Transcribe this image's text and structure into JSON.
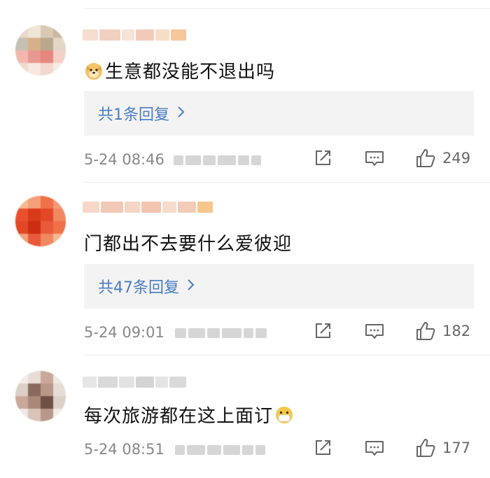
{
  "comments": [
    {
      "content": "生意都没能不退出吗",
      "emoji": "doge-emoji",
      "reply_label": "共1条回复",
      "time": "5-24 08:46",
      "likes": "249",
      "avatar_colors": [
        "#e8d9c8",
        "#f0e6d8",
        "#d8c8b4",
        "#c9b7a4",
        "#f2b8b0",
        "#e89890",
        "#f5d0c8",
        "#eeddcc",
        "#f8e8e0"
      ]
    },
    {
      "content": "门都出不去要什么爱彼迎",
      "emoji": "",
      "reply_label": "共47条回复",
      "time": "5-24 09:01",
      "likes": "182",
      "avatar_colors": [
        "#f4a078",
        "#e85030",
        "#f08860",
        "#d83a1a",
        "#e24828",
        "#f07048",
        "#f6b890",
        "#ea5a3a",
        "#f49a78"
      ]
    },
    {
      "content": "每次旅游都在这上面订",
      "emoji": "mask-face-emoji",
      "reply_label": "",
      "time": "5-24 08:51",
      "likes": "177",
      "avatar_colors": [
        "#f3ece8",
        "#c9a89a",
        "#e8ddd6",
        "#8a6a5c",
        "#b89888",
        "#ddd0c8",
        "#f0e8e4",
        "#a88878",
        "#e6dcd6"
      ]
    }
  ],
  "icons": {
    "share": "share-icon",
    "comment": "comment-icon",
    "like": "thumbs-up-icon",
    "chevron": "chevron-right-icon"
  },
  "colors": {
    "reply_link": "#4a7cc2",
    "reply_bg": "#f3f3f3",
    "meta_text": "#888888"
  }
}
